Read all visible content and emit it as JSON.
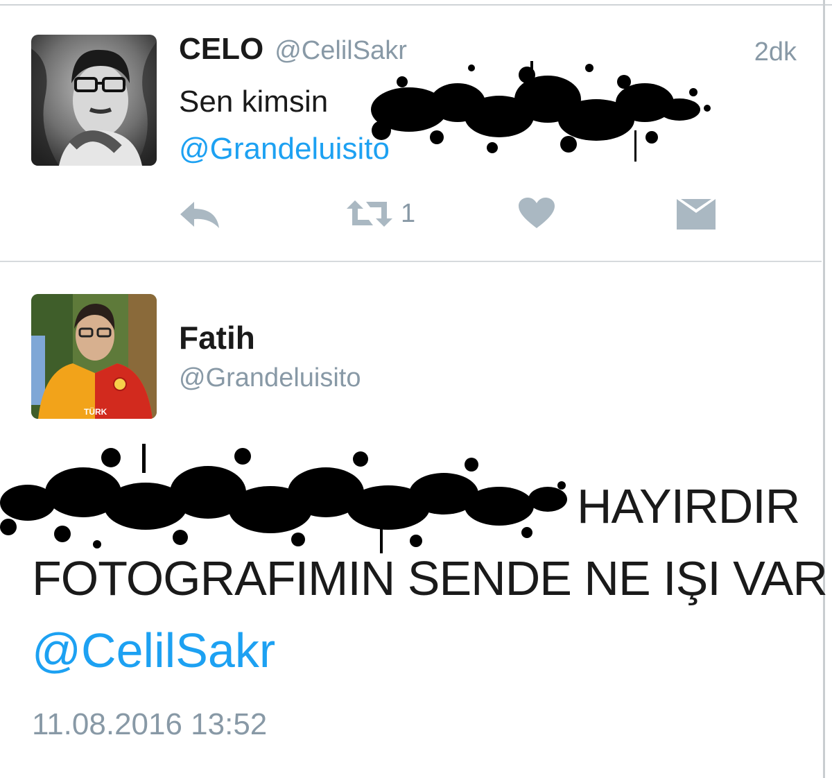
{
  "colors": {
    "accent": "#1da1f2",
    "muted": "#8899a6",
    "text": "#1a1a1a"
  },
  "reply_tweet": {
    "display_name": "CELO",
    "handle": "@CelilSakr",
    "time_ago": "2dk",
    "text_visible": "Sen kimsin",
    "mention": "@Grandeluisito",
    "actions": {
      "reply_icon": "reply-icon",
      "retweet_icon": "retweet-icon",
      "retweet_count": "1",
      "like_icon": "heart-icon",
      "dm_icon": "envelope-icon"
    }
  },
  "main_tweet": {
    "display_name": "Fatih",
    "handle": "@Grandeluisito",
    "text_line1_visible": "HAYIRDIR",
    "text_line2": "FOTOGRAFIMIN SENDE NE IŞI VAR",
    "mention": "@CelilSakr",
    "timestamp": "11.08.2016 13:52"
  }
}
